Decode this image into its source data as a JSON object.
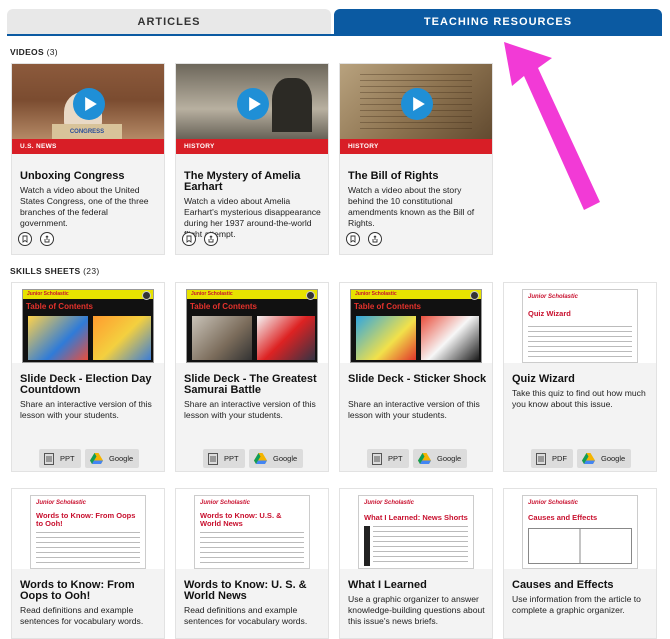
{
  "tabs": {
    "articles": "ARTICLES",
    "teaching": "TEACHING RESOURCES"
  },
  "videos": {
    "label": "VIDEOS",
    "count": "(3)",
    "items": [
      {
        "tag": "U.S. NEWS",
        "title": "Unboxing Congress",
        "desc": "Watch a video about the United States Congress, one of the three branches of the federal government.",
        "thumb_text": "CONGRESS"
      },
      {
        "tag": "HISTORY",
        "title": "The Mystery of Amelia Earhart",
        "desc": "Watch a video about Amelia Earhart's mysterious disappearance during her 1937 around-the-world flight attempt."
      },
      {
        "tag": "HISTORY",
        "title": "The Bill of Rights",
        "desc": "Watch a video about the story behind the 10 constitutional amendments known as the Bill of Rights."
      }
    ]
  },
  "skills": {
    "label": "SKILLS SHEETS",
    "count": "(23)",
    "items": [
      {
        "title": "Slide Deck - Election Day Countdown",
        "desc": "Share an interactive version of this lesson with your students.",
        "thumb_heading": "Table of Contents",
        "buttons": [
          "PPT",
          "Google"
        ]
      },
      {
        "title": "Slide Deck - The Greatest Samurai Battle",
        "desc": "Share an interactive version of this lesson with your students.",
        "thumb_heading": "Table of Contents",
        "buttons": [
          "PPT",
          "Google"
        ]
      },
      {
        "title": "Slide Deck - Sticker Shock",
        "desc": "Share an interactive version of this lesson with your students.",
        "thumb_heading": "Table of Contents",
        "buttons": [
          "PPT",
          "Google"
        ]
      },
      {
        "title": "Quiz Wizard",
        "desc": "Take this quiz to find out how much you know about this issue.",
        "thumb_heading": "Quiz Wizard",
        "buttons": [
          "PDF",
          "Google"
        ]
      },
      {
        "title": "Words to Know: From Oops to Ooh!",
        "desc": "Read definitions and example sentences for vocabulary words.",
        "thumb_heading": "Words to Know: From Oops to Ooh!"
      },
      {
        "title": "Words to Know: U. S. & World News",
        "desc": "Read definitions and example sentences for vocabulary words.",
        "thumb_heading": "Words to Know: U.S. & World News"
      },
      {
        "title": "What I Learned",
        "desc": "Use a graphic organizer to answer knowledge-building questions about this issue's news briefs.",
        "thumb_heading": "What I Learned: News Shorts"
      },
      {
        "title": "Causes and Effects",
        "desc": "Use information from the article to complete a graphic organizer.",
        "thumb_heading": "Causes and Effects"
      }
    ]
  },
  "brand": "Junior Scholastic",
  "colors": {
    "accent": "#0b5aa2",
    "tag_red": "#d81e26",
    "arrow": "#f23ad6",
    "play": "#1f8fd6"
  }
}
